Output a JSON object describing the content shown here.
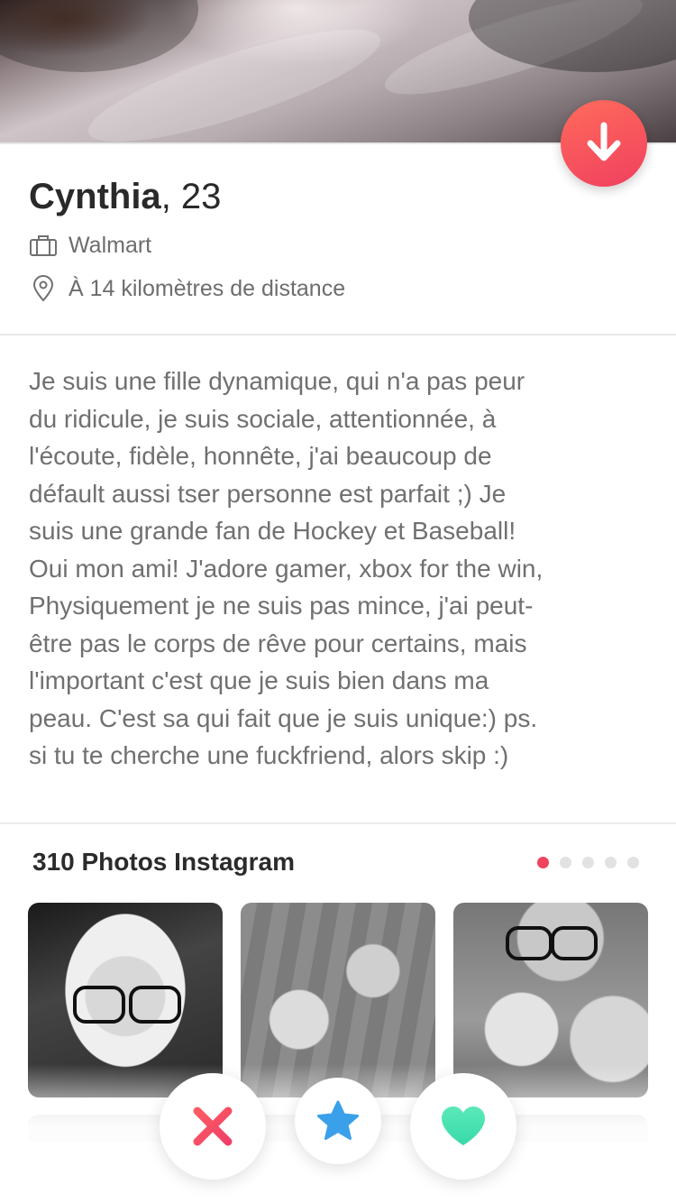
{
  "profile": {
    "name": "Cynthia",
    "age_text": ", 23",
    "job": "Walmart",
    "distance": "À 14 kilomètres de distance"
  },
  "bio": {
    "lines": [
      "Je suis une fille dynamique, qui n'a pas peur",
      "du ridicule, je suis sociale, attentionnée, à",
      "l'écoute, fidèle, honnête, j'ai beaucoup de",
      "défault aussi tser personne est parfait ;) Je",
      "suis une grande fan de Hockey et Baseball!",
      "Oui mon ami! J'adore gamer, xbox for the win,",
      "Physiquement je ne suis pas mince, j'ai peut-",
      "être pas le corps de rêve pour certains, mais",
      "l'important c'est que je suis bien dans ma",
      "peau. C'est sa qui fait que je suis unique:) ps.",
      "si tu te cherche une fuckfriend, alors skip :)"
    ]
  },
  "instagram": {
    "title": "310 Photos Instagram",
    "page_count": 5,
    "active_page": 1
  },
  "icons": {
    "collapse": "arrow-down-icon",
    "job": "briefcase-icon",
    "location": "location-pin-icon",
    "nope": "x-icon",
    "super_like": "star-icon",
    "like": "heart-icon"
  },
  "colors": {
    "accent": "#f0435e",
    "nope": "#f0455e",
    "super_like": "#3aa0ea",
    "like": "#48e0b4",
    "text_secondary": "#707070"
  }
}
